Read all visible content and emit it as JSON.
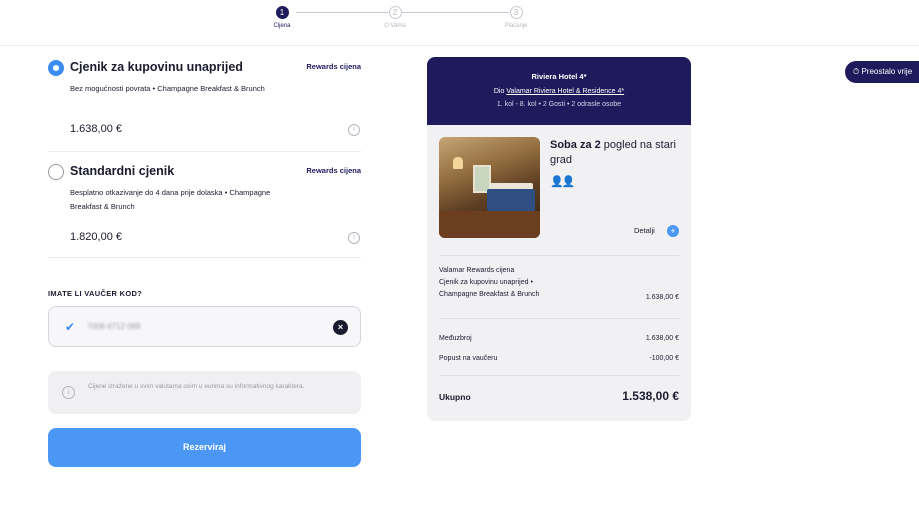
{
  "stepper": {
    "steps": [
      {
        "number": "1",
        "label": "Cijena",
        "state": "active"
      },
      {
        "number": "2",
        "label": "O Vama",
        "state": "inactive"
      },
      {
        "number": "3",
        "label": "Plaćanje",
        "state": "inactive"
      }
    ]
  },
  "timer_button": {
    "label": "⏱ Preostalo vrije"
  },
  "rates": [
    {
      "title": "Cjenik za kupovinu unaprijed",
      "tag": "Rewards cijena",
      "description": "Bez mogućnosti povrata  •  Champagne Breakfast & Brunch",
      "price": "1.638,00 €",
      "selected": true
    },
    {
      "title": "Standardni cjenik",
      "tag": "Rewards cijena",
      "description": "Besplatno otkazivanje do 4 dana prije dolaska  •  Champagne Breakfast & Brunch",
      "price": "1.820,00 €",
      "selected": false
    }
  ],
  "voucher": {
    "heading": "IMATE LI VAUČER KOD?",
    "value": "7008 4712 088"
  },
  "notice": {
    "text": "Cijene izražene u svim valutama osim u eurima su informativnog karaktera."
  },
  "reserve_button": {
    "label": "Rezerviraj"
  },
  "summary": {
    "hotel_name": "Riviera Hotel 4*",
    "part_of_prefix": "Dio",
    "part_of_link": "Valamar Riviera Hotel & Residence 4*",
    "dates_guests": "1. kol - 8. kol  •  2 Gosti  •  2 odrasle osobe",
    "room_title_bold": "Soba za 2",
    "room_title_rest": " pogled na stari grad",
    "guest_icon": "👥",
    "details_label": "Detalji",
    "rate_lines": [
      "Valamar Rewards cijena",
      "Cjenik za kupovinu unaprijed  •",
      "Champagne Breakfast & Brunch"
    ],
    "rate_amount": "1.638,00 €",
    "subtotal_label": "Međuzbroj",
    "subtotal_amount": "1.638,00 €",
    "discount_label": "Popust na vaučeru",
    "discount_amount": "-100,00 €",
    "total_label": "Ukupno",
    "total_amount": "1.538,00 €"
  },
  "colors": {
    "brand_navy": "#1f1a5c",
    "accent_blue": "#4a97f5",
    "card_bg": "#f1f1f3"
  }
}
